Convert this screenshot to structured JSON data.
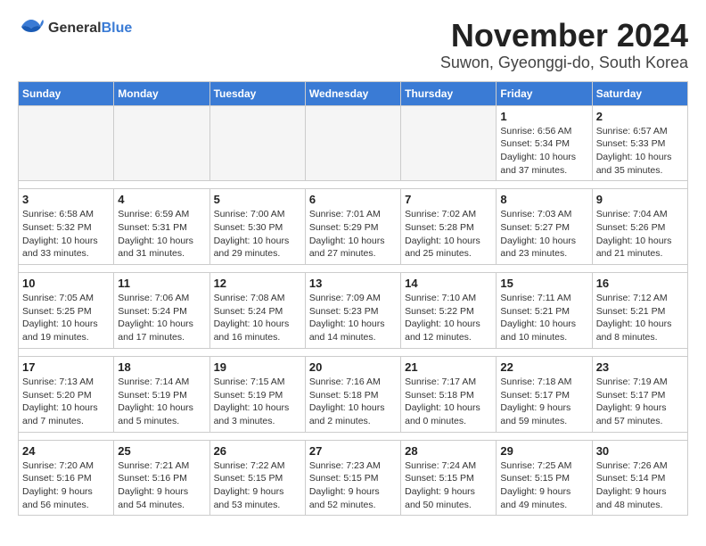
{
  "logo": {
    "general": "General",
    "blue": "Blue"
  },
  "title": "November 2024",
  "location": "Suwon, Gyeonggi-do, South Korea",
  "weekdays": [
    "Sunday",
    "Monday",
    "Tuesday",
    "Wednesday",
    "Thursday",
    "Friday",
    "Saturday"
  ],
  "weeks": [
    [
      {
        "day": "",
        "info": ""
      },
      {
        "day": "",
        "info": ""
      },
      {
        "day": "",
        "info": ""
      },
      {
        "day": "",
        "info": ""
      },
      {
        "day": "",
        "info": ""
      },
      {
        "day": "1",
        "info": "Sunrise: 6:56 AM\nSunset: 5:34 PM\nDaylight: 10 hours and 37 minutes."
      },
      {
        "day": "2",
        "info": "Sunrise: 6:57 AM\nSunset: 5:33 PM\nDaylight: 10 hours and 35 minutes."
      }
    ],
    [
      {
        "day": "3",
        "info": "Sunrise: 6:58 AM\nSunset: 5:32 PM\nDaylight: 10 hours and 33 minutes."
      },
      {
        "day": "4",
        "info": "Sunrise: 6:59 AM\nSunset: 5:31 PM\nDaylight: 10 hours and 31 minutes."
      },
      {
        "day": "5",
        "info": "Sunrise: 7:00 AM\nSunset: 5:30 PM\nDaylight: 10 hours and 29 minutes."
      },
      {
        "day": "6",
        "info": "Sunrise: 7:01 AM\nSunset: 5:29 PM\nDaylight: 10 hours and 27 minutes."
      },
      {
        "day": "7",
        "info": "Sunrise: 7:02 AM\nSunset: 5:28 PM\nDaylight: 10 hours and 25 minutes."
      },
      {
        "day": "8",
        "info": "Sunrise: 7:03 AM\nSunset: 5:27 PM\nDaylight: 10 hours and 23 minutes."
      },
      {
        "day": "9",
        "info": "Sunrise: 7:04 AM\nSunset: 5:26 PM\nDaylight: 10 hours and 21 minutes."
      }
    ],
    [
      {
        "day": "10",
        "info": "Sunrise: 7:05 AM\nSunset: 5:25 PM\nDaylight: 10 hours and 19 minutes."
      },
      {
        "day": "11",
        "info": "Sunrise: 7:06 AM\nSunset: 5:24 PM\nDaylight: 10 hours and 17 minutes."
      },
      {
        "day": "12",
        "info": "Sunrise: 7:08 AM\nSunset: 5:24 PM\nDaylight: 10 hours and 16 minutes."
      },
      {
        "day": "13",
        "info": "Sunrise: 7:09 AM\nSunset: 5:23 PM\nDaylight: 10 hours and 14 minutes."
      },
      {
        "day": "14",
        "info": "Sunrise: 7:10 AM\nSunset: 5:22 PM\nDaylight: 10 hours and 12 minutes."
      },
      {
        "day": "15",
        "info": "Sunrise: 7:11 AM\nSunset: 5:21 PM\nDaylight: 10 hours and 10 minutes."
      },
      {
        "day": "16",
        "info": "Sunrise: 7:12 AM\nSunset: 5:21 PM\nDaylight: 10 hours and 8 minutes."
      }
    ],
    [
      {
        "day": "17",
        "info": "Sunrise: 7:13 AM\nSunset: 5:20 PM\nDaylight: 10 hours and 7 minutes."
      },
      {
        "day": "18",
        "info": "Sunrise: 7:14 AM\nSunset: 5:19 PM\nDaylight: 10 hours and 5 minutes."
      },
      {
        "day": "19",
        "info": "Sunrise: 7:15 AM\nSunset: 5:19 PM\nDaylight: 10 hours and 3 minutes."
      },
      {
        "day": "20",
        "info": "Sunrise: 7:16 AM\nSunset: 5:18 PM\nDaylight: 10 hours and 2 minutes."
      },
      {
        "day": "21",
        "info": "Sunrise: 7:17 AM\nSunset: 5:18 PM\nDaylight: 10 hours and 0 minutes."
      },
      {
        "day": "22",
        "info": "Sunrise: 7:18 AM\nSunset: 5:17 PM\nDaylight: 9 hours and 59 minutes."
      },
      {
        "day": "23",
        "info": "Sunrise: 7:19 AM\nSunset: 5:17 PM\nDaylight: 9 hours and 57 minutes."
      }
    ],
    [
      {
        "day": "24",
        "info": "Sunrise: 7:20 AM\nSunset: 5:16 PM\nDaylight: 9 hours and 56 minutes."
      },
      {
        "day": "25",
        "info": "Sunrise: 7:21 AM\nSunset: 5:16 PM\nDaylight: 9 hours and 54 minutes."
      },
      {
        "day": "26",
        "info": "Sunrise: 7:22 AM\nSunset: 5:15 PM\nDaylight: 9 hours and 53 minutes."
      },
      {
        "day": "27",
        "info": "Sunrise: 7:23 AM\nSunset: 5:15 PM\nDaylight: 9 hours and 52 minutes."
      },
      {
        "day": "28",
        "info": "Sunrise: 7:24 AM\nSunset: 5:15 PM\nDaylight: 9 hours and 50 minutes."
      },
      {
        "day": "29",
        "info": "Sunrise: 7:25 AM\nSunset: 5:15 PM\nDaylight: 9 hours and 49 minutes."
      },
      {
        "day": "30",
        "info": "Sunrise: 7:26 AM\nSunset: 5:14 PM\nDaylight: 9 hours and 48 minutes."
      }
    ]
  ]
}
